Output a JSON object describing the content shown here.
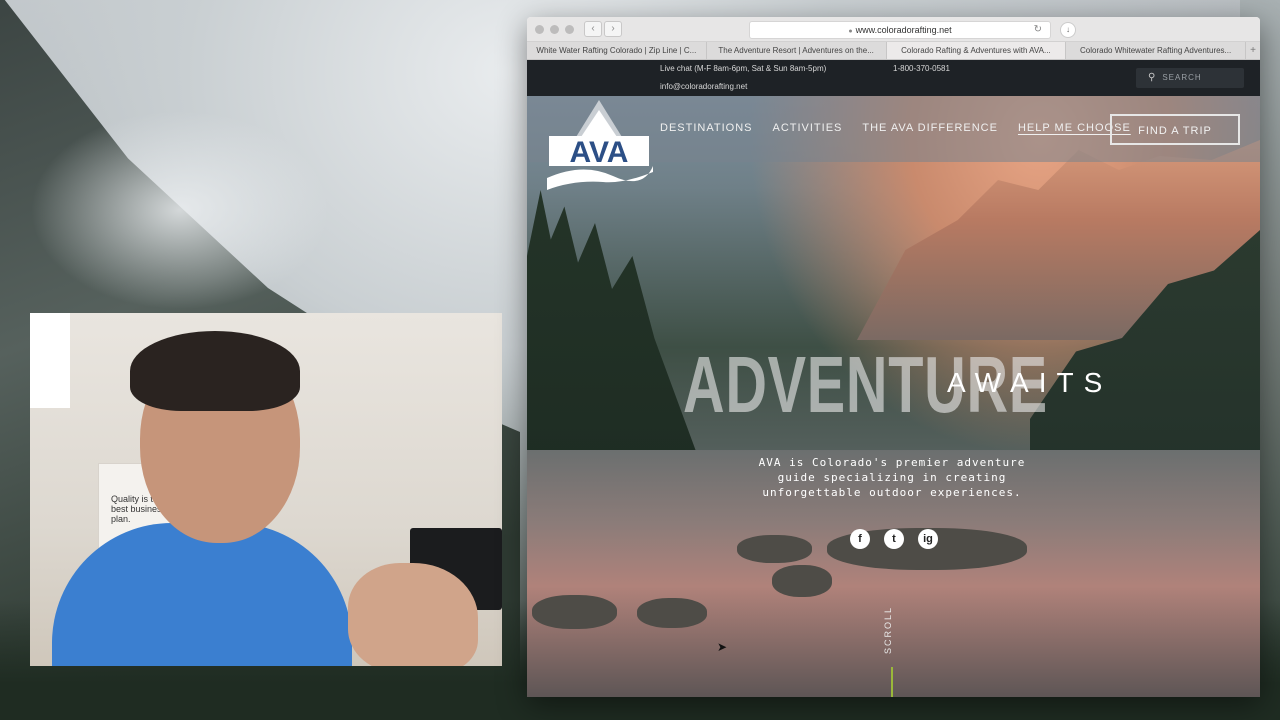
{
  "browser": {
    "url": "www.coloradorafting.net",
    "tabs": [
      "White Water Rafting Colorado | Zip Line | C...",
      "The Adventure Resort | Adventures on the...",
      "Colorado Rafting & Adventures with AVA...",
      "Colorado Whitewater Rafting Adventures..."
    ],
    "active_tab": 2,
    "new_tab": "+"
  },
  "topbar": {
    "live_chat": "Live chat (M-F 8am-6pm, Sat & Sun 8am-5pm)",
    "phone": "1-800-370-0581",
    "email": "info@coloradorafting.net",
    "search_placeholder": "SEARCH"
  },
  "logo": {
    "text": "AVA"
  },
  "nav": {
    "links": [
      "DESTINATIONS",
      "ACTIVITIES",
      "THE AVA DIFFERENCE",
      "HELP ME CHOOSE"
    ],
    "cta": "FIND A TRIP"
  },
  "hero": {
    "headline": "ADVENTURE",
    "subheadline": "AWAITS",
    "tagline": "AVA is Colorado's premier adventure guide specializing in creating unforgettable outdoor experiences.",
    "socials": [
      "f",
      "t",
      "ig"
    ],
    "scroll": "SCROLL"
  },
  "webcam": {
    "poster_text": "Quality is the best business plan."
  },
  "colors": {
    "topbar": "#1e2226",
    "scroll_accent": "#9ab83a",
    "logo_blue": "#2c4f86"
  }
}
